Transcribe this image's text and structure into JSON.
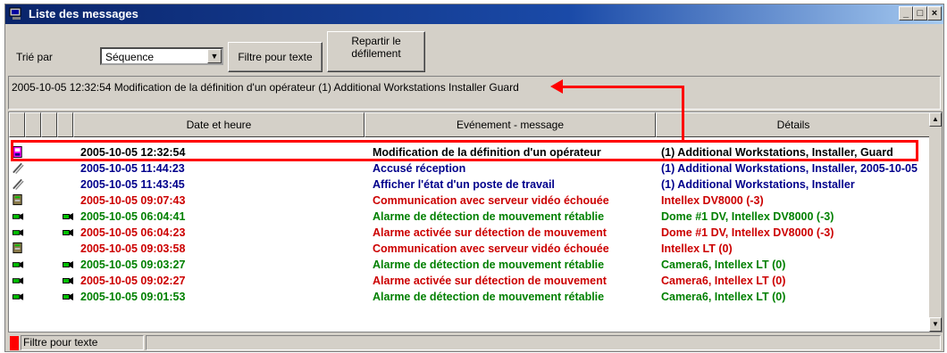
{
  "window": {
    "title": "Liste des messages",
    "controls": [
      "_",
      "□",
      "×"
    ]
  },
  "toolbar": {
    "sort_label": "Trié par",
    "sort_value": "Séquence",
    "filter_button": "Filtre pour texte",
    "repartir_line1": "Repartir le",
    "repartir_line2": "défilement"
  },
  "message": "2005-10-05 12:32:54  Modification de la définition d'un opérateur  (1) Additional Workstations  Installer  Guard",
  "columns": {
    "date": "Date et heure",
    "event": "Evénement - message",
    "details": "Détails"
  },
  "colors": {
    "black": "#000000",
    "blue": "#00008b",
    "red": "#cc0000",
    "green": "#008000",
    "annotation": "#ff0000"
  },
  "rows": [
    {
      "icon": "operator-icon",
      "date": "2005-10-05 12:32:54",
      "event": "Modification de la définition d'un opérateur",
      "details": "(1) Additional Workstations, Installer, Guard",
      "color": "black",
      "cam": false
    },
    {
      "icon": "pen-icon",
      "date": "2005-10-05 11:44:23",
      "event": "Accusé réception",
      "details": "(1) Additional Workstations, Installer, 2005-10-05",
      "color": "blue",
      "cam": false
    },
    {
      "icon": "pen-icon",
      "date": "2005-10-05 11:43:45",
      "event": "Afficher l'état d'un poste de travail",
      "details": "(1) Additional Workstations, Installer",
      "color": "blue",
      "cam": false
    },
    {
      "icon": "server-icon",
      "date": "2005-10-05 09:07:43",
      "event": "Communication avec serveur vidéo échouée",
      "details": "Intellex DV8000 (-3)",
      "color": "red",
      "cam": false
    },
    {
      "icon": "camera-icon",
      "date": "2005-10-05 06:04:41",
      "event": "Alarme de détection de mouvement rétablie",
      "details": "Dome #1 DV, Intellex DV8000 (-3)",
      "color": "green",
      "cam": true
    },
    {
      "icon": "camera-icon",
      "date": "2005-10-05 06:04:23",
      "event": "Alarme activée sur détection de mouvement",
      "details": "Dome #1 DV, Intellex DV8000 (-3)",
      "color": "red",
      "cam": true
    },
    {
      "icon": "server-icon",
      "date": "2005-10-05 09:03:58",
      "event": "Communication avec serveur vidéo échouée",
      "details": "Intellex LT (0)",
      "color": "red",
      "cam": false
    },
    {
      "icon": "camera-icon",
      "date": "2005-10-05 09:03:27",
      "event": "Alarme de détection de mouvement rétablie",
      "details": "Camera6, Intellex LT (0)",
      "color": "green",
      "cam": true
    },
    {
      "icon": "camera-icon",
      "date": "2005-10-05 09:02:27",
      "event": "Alarme activée sur détection de mouvement",
      "details": "Camera6, Intellex LT (0)",
      "color": "red",
      "cam": true
    },
    {
      "icon": "camera-icon",
      "date": "2005-10-05 09:01:53",
      "event": "Alarme de détection de mouvement rétablie",
      "details": "Camera6, Intellex LT (0)",
      "color": "green",
      "cam": true
    }
  ],
  "status": {
    "text": "Filtre pour texte"
  }
}
